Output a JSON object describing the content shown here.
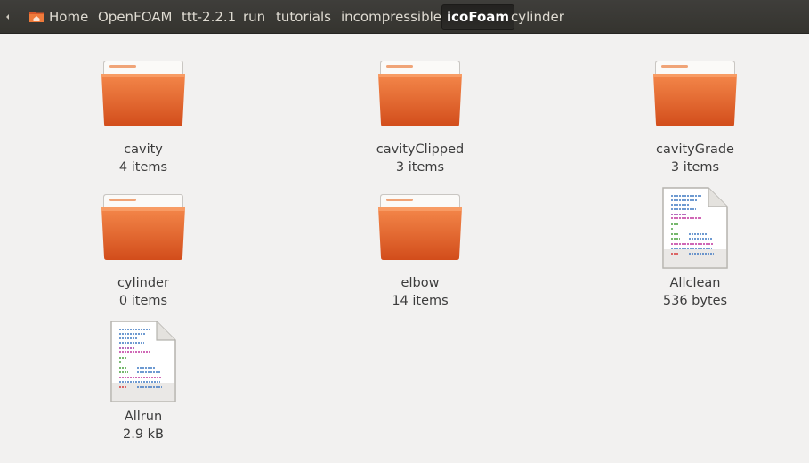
{
  "pathbar": {
    "crumbs": [
      "Home",
      "OpenFOAM",
      "ttt-2.2.1",
      "run",
      "tutorials",
      "incompressible",
      "icoFoam",
      "cylinder"
    ],
    "active_index": 6
  },
  "items": [
    {
      "name": "cavity",
      "meta": "4 items",
      "kind": "folder"
    },
    {
      "name": "cavityClipped",
      "meta": "3 items",
      "kind": "folder"
    },
    {
      "name": "cavityGrade",
      "meta": "3 items",
      "kind": "folder"
    },
    {
      "name": "cylinder",
      "meta": "0 items",
      "kind": "folder"
    },
    {
      "name": "elbow",
      "meta": "14 items",
      "kind": "folder"
    },
    {
      "name": "Allclean",
      "meta": "536 bytes",
      "kind": "script-file"
    },
    {
      "name": "Allrun",
      "meta": "2.9 kB",
      "kind": "script-file"
    }
  ],
  "icons": {
    "home": "home-folder-icon",
    "folder": "folder-icon",
    "file": "text-file-icon",
    "scroll": "chevron-left-icon"
  },
  "colors": {
    "pathbar_bg": "#3a3935",
    "window_bg": "#f2f1f0",
    "folder_orange": "#e9672d",
    "folder_tab": "#f0a477",
    "text": "#3c3c3c"
  }
}
